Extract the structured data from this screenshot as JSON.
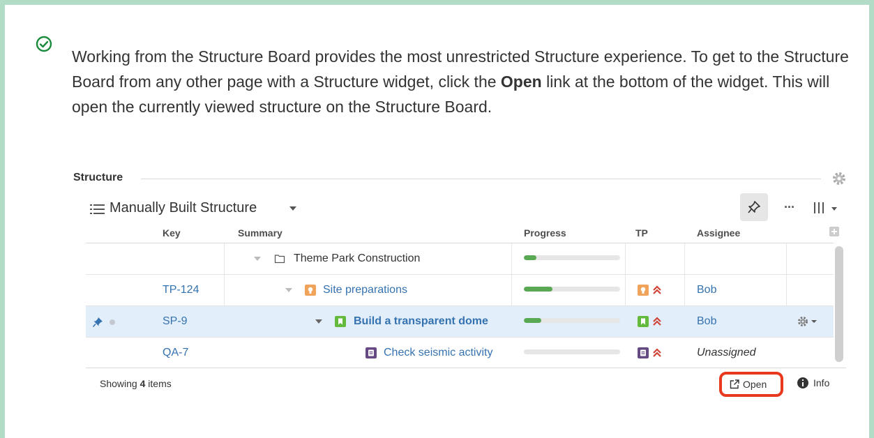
{
  "intro": {
    "text_before": "Working from the Structure Board provides the most unrestricted Structure experience. To get to the Structure Board from any other page with a Structure widget, click the ",
    "bold": "Open",
    "text_after": " link at the bottom of the widget. This will open the currently viewed structure on the Structure Board."
  },
  "widget": {
    "title": "Structure",
    "structure_name": "Manually Built Structure",
    "more_label": "···"
  },
  "table": {
    "columns": {
      "key": "Key",
      "summary": "Summary",
      "progress": "Progress",
      "tp": "TP",
      "assignee": "Assignee"
    },
    "rows": [
      {
        "key": "",
        "summary": "Theme Park Construction",
        "progress": 0.13,
        "assignee": ""
      },
      {
        "key": "TP-124",
        "summary": "Site preparations",
        "progress": 0.3,
        "assignee": "Bob"
      },
      {
        "key": "SP-9",
        "summary": "Build a transparent dome",
        "progress": 0.18,
        "assignee": "Bob"
      },
      {
        "key": "QA-7",
        "summary": "Check seismic activity",
        "progress": 0.0,
        "assignee": "Unassigned"
      }
    ]
  },
  "footer": {
    "showing_prefix": "Showing ",
    "showing_count": "4",
    "showing_suffix": " items",
    "open_label": "Open",
    "info_label": "Info"
  },
  "colors": {
    "panel_border": "#b3dcc7",
    "link": "#3572b0",
    "progress": "#59a954",
    "highlight": "#e8391f",
    "selected_row": "#e2effb"
  },
  "icons": [
    "check-circle-icon",
    "gear-icon",
    "structure-list-icon",
    "pin-icon",
    "columns-icon",
    "folder-icon",
    "story-icon",
    "task-icon",
    "priority-highest-icon",
    "external-link-icon",
    "info-icon"
  ]
}
